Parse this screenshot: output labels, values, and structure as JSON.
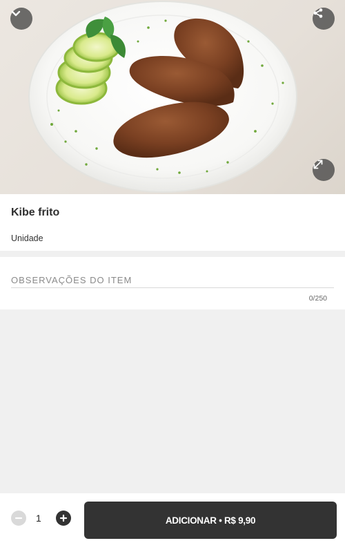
{
  "product": {
    "image_alt": "Kibe frito",
    "name": "Kibe frito",
    "unit": "Unidade"
  },
  "header": {
    "collapse_icon": "chevron-down-icon",
    "share_icon": "share-icon",
    "expand_icon": "expand-icon"
  },
  "observations": {
    "placeholder": "OBSERVAÇÕES DO ITEM",
    "value": "",
    "counter": "0/250"
  },
  "cart": {
    "quantity": "1",
    "minus_icon": "minus-icon",
    "plus_icon": "plus-icon",
    "add_label": "ADICIONAR • R$ 9,90"
  },
  "colors": {
    "accent": "#333333",
    "background": "#f0f0f0",
    "card": "#ffffff"
  }
}
